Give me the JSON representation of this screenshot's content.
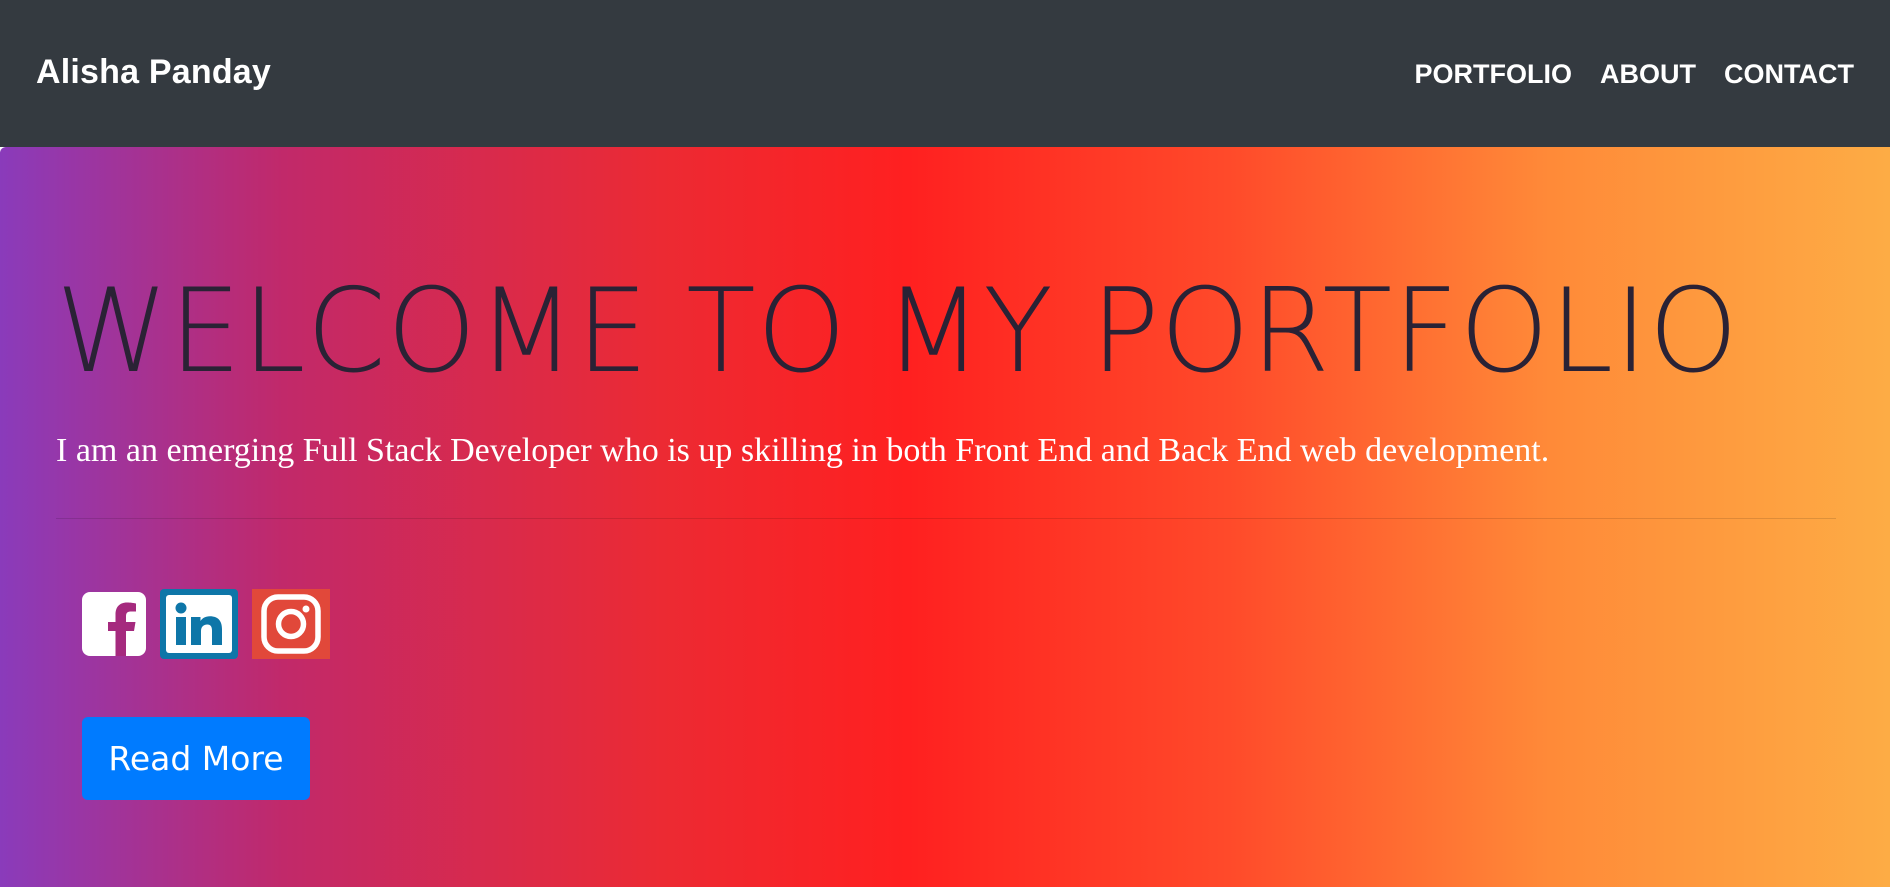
{
  "navbar": {
    "brand": "Alisha Panday",
    "links": [
      {
        "label": "PORTFOLIO"
      },
      {
        "label": "ABOUT"
      },
      {
        "label": "CONTACT"
      }
    ]
  },
  "hero": {
    "title": "WELCOME TO MY PORTFOLIO",
    "subtitle": "I am an emerging Full Stack Developer who is up skilling in both Front End and Back End web development.",
    "social": [
      {
        "icon": "facebook-icon",
        "color": "#ffffff"
      },
      {
        "icon": "linkedin-icon",
        "color": "#0e76a8"
      },
      {
        "icon": "instagram-icon",
        "color": "#e1483a"
      }
    ],
    "button_label": "Read More"
  },
  "colors": {
    "navbar_bg": "#343a40",
    "button_bg": "#007bff",
    "gradient": [
      "#8a3bbb",
      "#c1296a",
      "#ff2020",
      "#ff8a38",
      "#fdac45"
    ]
  }
}
